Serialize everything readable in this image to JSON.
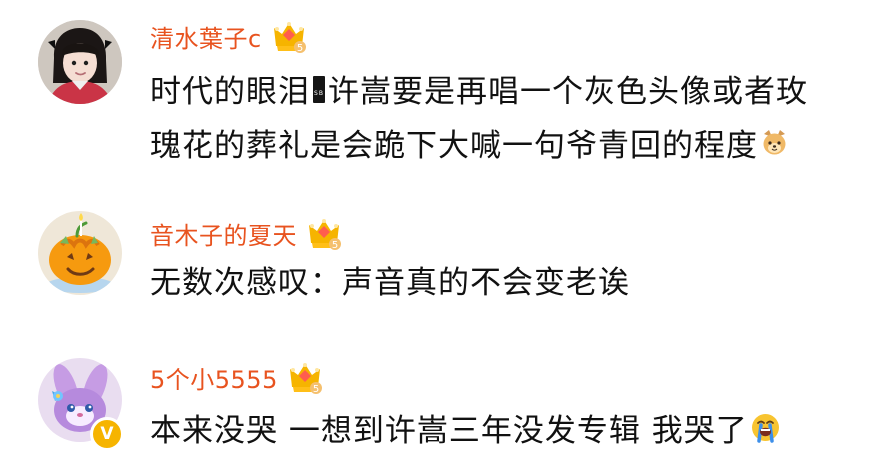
{
  "comments": [
    {
      "username": "清水葉子c",
      "text_parts": [
        "时代的眼泪",
        "许嵩要是再唱一个灰色头像或者玫",
        "瑰花的葬礼是会跪下大喊一句爷青回的程度"
      ],
      "emojis": [
        "black-tag-emoji",
        "dog-face-emoji"
      ],
      "vip_badge_icon": "gold-crown-badge",
      "avatar_icon": "girl-avatar"
    },
    {
      "username": "音木子的夏天",
      "text": "无数次感叹：声音真的不会变老诶",
      "vip_badge_icon": "gold-crown-badge",
      "avatar_icon": "pumpkin-cake-avatar"
    },
    {
      "username": "5个小5555",
      "text_parts": [
        "本来没哭 一想到许嵩三年没发专辑 我哭了"
      ],
      "emojis": [
        "crying-face-emoji"
      ],
      "vip_badge_icon": "gold-crown-badge",
      "avatar_icon": "purple-bunny-avatar",
      "verified_icon": "yellow-v-badge"
    }
  ],
  "colors": {
    "username": "#e8531f",
    "text": "#111111",
    "background": "#ffffff",
    "crown": "#f6b400",
    "verified": "#f6b400"
  }
}
